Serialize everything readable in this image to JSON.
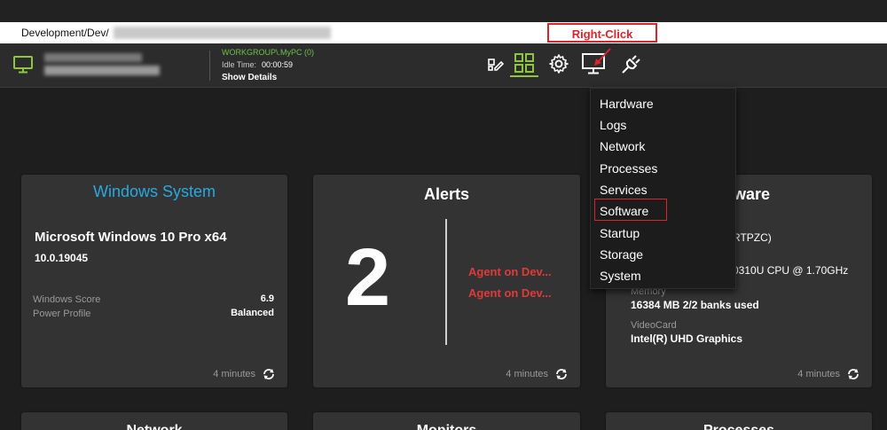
{
  "breadcrumb": {
    "path": "Development/Dev/"
  },
  "annotation": {
    "label": "Right-Click",
    "color": "#d9252b"
  },
  "header": {
    "workgroup": "WORKGROUP\\.MyPC (0)",
    "idle_label": "Idle Time:",
    "idle_value": "00:00:59",
    "show_details": "Show Details",
    "toolbar": [
      "edit-icon",
      "dashboard-grid-icon",
      "gear-icon",
      "monitor-icon",
      "plug-icon"
    ]
  },
  "colors": {
    "accent_green": "#8dc63f",
    "title_blue": "#27a9e1",
    "alert_red": "#e2393a"
  },
  "cards": {
    "windows": {
      "title": "Windows System",
      "os_name": "Microsoft Windows 10 Pro x64",
      "os_version": "10.0.19045",
      "score_label": "Windows Score",
      "score_value": "6.9",
      "power_label": "Power Profile",
      "power_value": "Balanced",
      "updated": "4 minutes"
    },
    "alerts": {
      "title": "Alerts",
      "count": "2",
      "items": [
        "Agent on Dev...",
        "Agent on Dev..."
      ],
      "updated": "4 minutes"
    },
    "hardware": {
      "title_partial": "dware",
      "model_partial": "RTPZC)",
      "cpu_partial": "0310U CPU @ 1.70GHz",
      "memory_label": "Memory",
      "memory_value": "16384 MB 2/2 banks used",
      "video_label": "VideoCard",
      "video_value": "Intel(R) UHD Graphics",
      "updated": "4 minutes"
    },
    "bottom": [
      "Network",
      "Monitors",
      "Processes"
    ]
  },
  "context_menu": {
    "items": [
      "Hardware",
      "Logs",
      "Network",
      "Processes",
      "Services",
      "Software",
      "Startup",
      "Storage",
      "System"
    ],
    "highlighted": "Software"
  }
}
